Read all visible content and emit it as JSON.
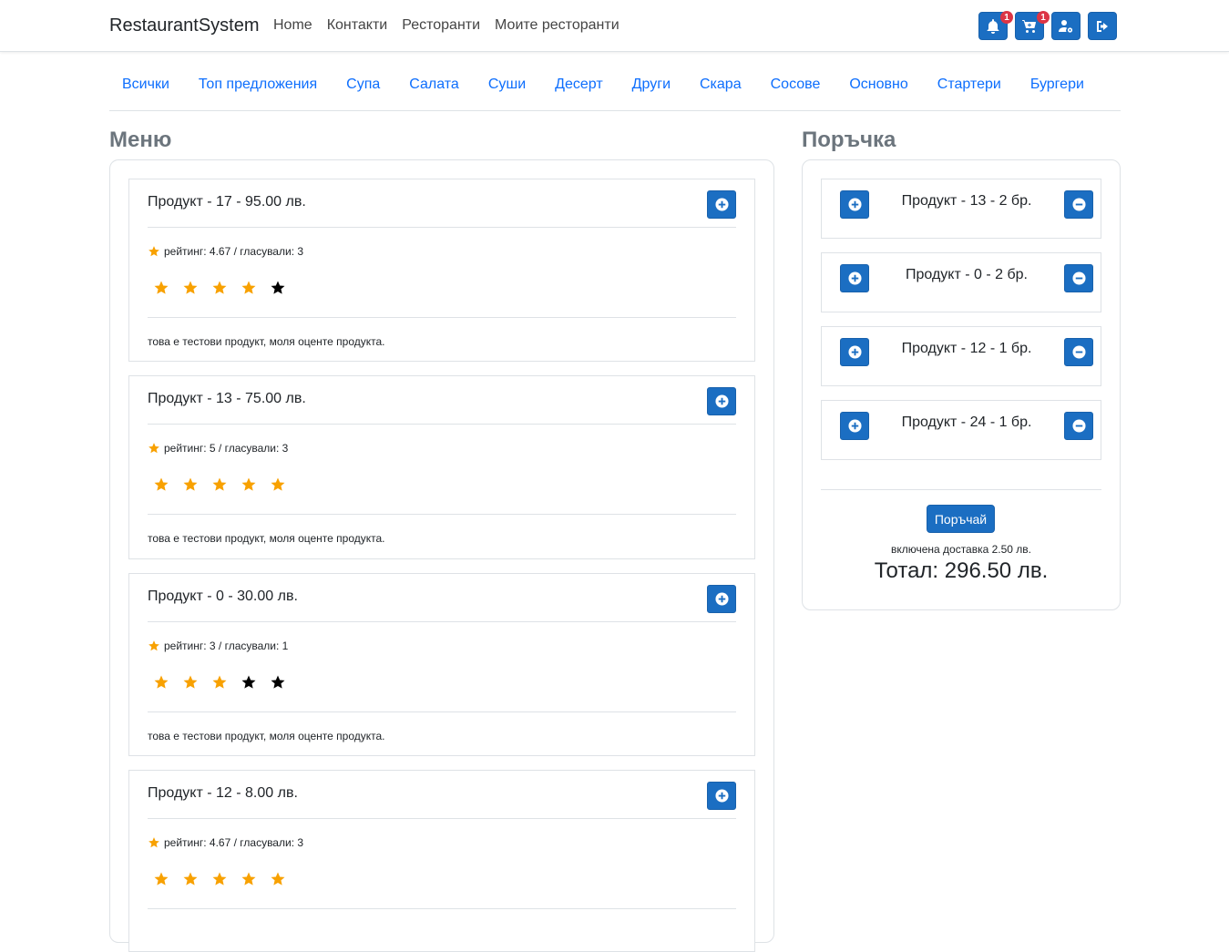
{
  "brand": "RestaurantSystem",
  "nav": [
    "Home",
    "Контакти",
    "Ресторанти",
    "Моите ресторанти"
  ],
  "nav_icons": {
    "notifications_badge": "1",
    "cart_badge": "1"
  },
  "categories": [
    "Всички",
    "Топ предложения",
    "Супа",
    "Салата",
    "Суши",
    "Десерт",
    "Други",
    "Скара",
    "Сосове",
    "Основно",
    "Стартери",
    "Бургери"
  ],
  "menu": {
    "title": "Меню",
    "products": [
      {
        "name": "Продукт - 17 - 95.00 лв.",
        "rating": "рейтинг: 4.67 / гласували: 3",
        "filled_stars": 4,
        "desc": "това е тестови продукт, моля оценте продукта."
      },
      {
        "name": "Продукт - 13 - 75.00 лв.",
        "rating": "рейтинг: 5 / гласували: 3",
        "filled_stars": 5,
        "desc": "това е тестови продукт, моля оценте продукта."
      },
      {
        "name": "Продукт - 0 - 30.00 лв.",
        "rating": "рейтинг: 3 / гласували: 1",
        "filled_stars": 3,
        "desc": "това е тестови продукт, моля оценте продукта."
      },
      {
        "name": "Продукт - 12 - 8.00 лв.",
        "rating": "рейтинг: 4.67 / гласували: 3",
        "filled_stars": 5,
        "desc": ""
      }
    ]
  },
  "order": {
    "title": "Поръчка",
    "items": [
      "Продукт - 13 - 2 бр.",
      "Продукт - 0 - 2 бр.",
      "Продукт - 12 - 1 бр.",
      "Продукт - 24 - 1 бр."
    ],
    "order_button": "Поръчай",
    "delivery": "включена доставка 2.50 лв.",
    "total": "Тотал: 296.50 лв."
  },
  "colors": {
    "primary": "#1b6ec2",
    "link": "#0d6efd",
    "star_filled": "#f8a100",
    "star_empty": "#000000",
    "badge": "#dc3545"
  }
}
